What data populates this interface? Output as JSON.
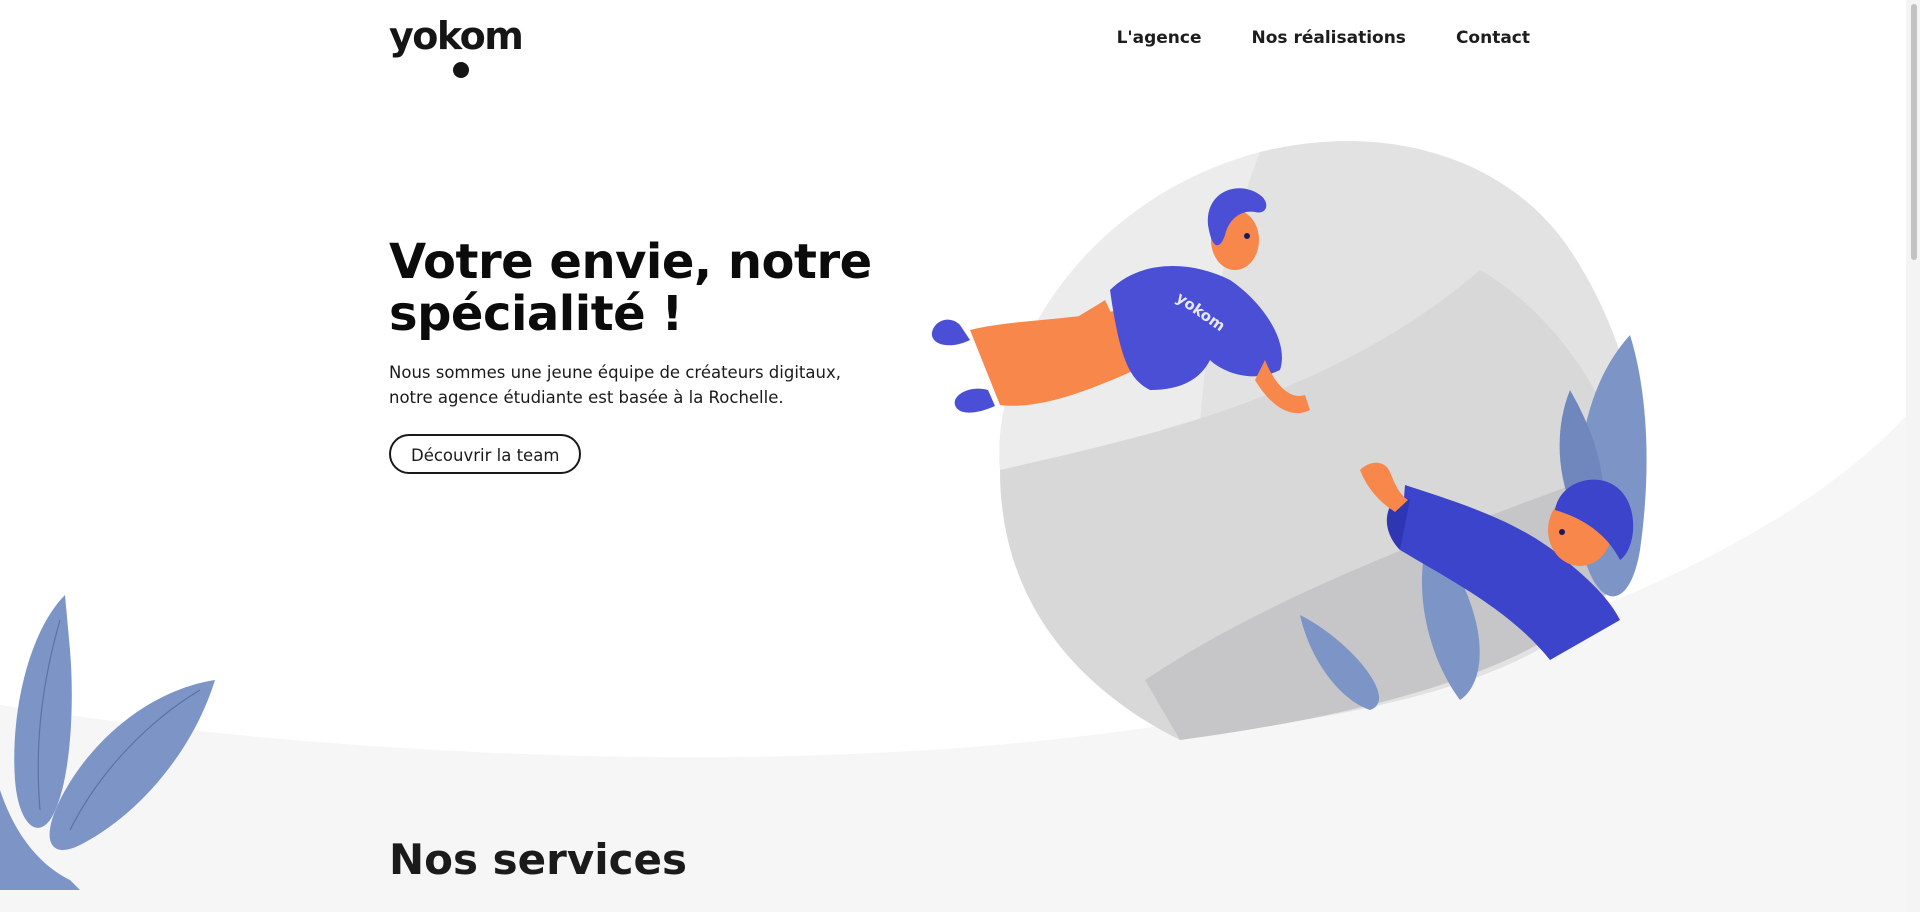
{
  "header": {
    "logo_text": "yokom",
    "nav": [
      "L'agence",
      "Nos réalisations",
      "Contact"
    ]
  },
  "hero": {
    "title": "Votre envie, notre spécialité !",
    "description": "Nous sommes une jeune équipe de créateurs digitaux, notre agence étudiante est basée à la Rochelle.",
    "cta_label": "Découvrir la team",
    "shirt_text": "yokom"
  },
  "services": {
    "title": "Nos services"
  },
  "colors": {
    "accent_blue": "#4a4fd6",
    "skin_orange": "#f7874a",
    "leaf_blue": "#7d95c6",
    "section_grey": "#f6f6f6",
    "text_dark": "#111111"
  },
  "icons": [
    "logo-mark",
    "hero-illustration",
    "leaf-decoration"
  ]
}
